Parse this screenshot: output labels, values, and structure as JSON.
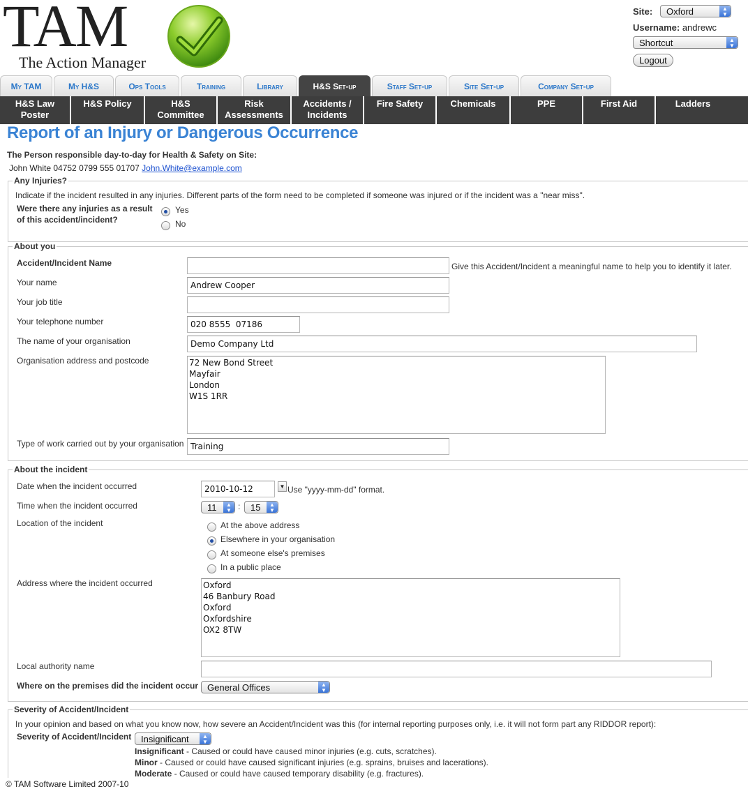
{
  "logo": {
    "wordmark": "TAM",
    "tagline": "The Action Manager"
  },
  "header": {
    "site_label": "Site:",
    "site_value": "Oxford",
    "username_label": "Username:",
    "username_value": "andrewc",
    "shortcut_value": "Shortcut",
    "logout_label": "Logout"
  },
  "tabs": [
    "My TAM",
    "My H&S",
    "Ops Tools",
    "Training",
    "Library",
    "H&S Set-up",
    "Staff Set-up",
    "Site Set-up",
    "Company Set-up"
  ],
  "subnav": [
    "H&S Law\nPoster",
    "H&S Policy",
    "H&S\nCommittee",
    "Risk\nAssessments",
    "Accidents /\nIncidents",
    "Fire Safety",
    "Chemicals",
    "PPE",
    "First Aid",
    "Ladders"
  ],
  "page_title": "Report of an Injury or Dangerous Occurrence",
  "responsible_heading": "The Person responsible day-to-day for Health & Safety on Site:",
  "responsible_contact": "John White 04752 0799 555 01707",
  "responsible_email": "John.White@example.com",
  "injuries": {
    "legend": "Any Injuries?",
    "intro": "Indicate if the incident resulted in any injuries. Different parts of the form need to be completed if someone was injured or if the incident was a \"near miss\".",
    "question": "Were there any injuries as a result\nof this accident/incident?",
    "options": [
      "Yes",
      "No"
    ],
    "selected": "Yes"
  },
  "about_you": {
    "legend": "About you",
    "incident_name_label": "Accident/Incident Name",
    "incident_name_value": "",
    "incident_name_help": "Give this Accident/Incident a meaningful name to help you to identify it later.",
    "name_label": "Your name",
    "name_value": "Andrew Cooper",
    "job_label": "Your job title",
    "job_value": "",
    "phone_label": "Your telephone number",
    "phone_value": "020 8555  07186",
    "org_label": "The name of your organisation",
    "org_value": "Demo Company Ltd",
    "address_label": "Organisation address and postcode",
    "address_value": "72 New Bond Street\nMayfair\nLondon\nW1S 1RR",
    "work_label": "Type of work carried out by your organisation",
    "work_value": "Training"
  },
  "incident": {
    "legend": "About the incident",
    "date_label": "Date when the incident occurred",
    "date_value": "2010-10-12",
    "date_help": "Use \"yyyy-mm-dd\" format.",
    "time_label": "Time when the incident occurred",
    "hour": "11",
    "minute": "15",
    "time_sep": ":",
    "location_label": "Location of the incident",
    "location_options": [
      "At the above address",
      "Elsewhere in your organisation",
      "At someone else's premises",
      "In a public place"
    ],
    "location_selected": "Elsewhere in your organisation",
    "address_label": "Address where the incident occurred",
    "address_value": "Oxford\n46 Banbury Road\nOxford\nOxfordshire\nOX2 8TW",
    "authority_label": "Local authority name",
    "authority_value": "",
    "premises_label": "Where on the premises did the incident occur",
    "premises_value": "General Offices"
  },
  "severity": {
    "legend": "Severity of Accident/Incident",
    "intro": "In your opinion and based on what you know now, how severe an Accident/Incident was this (for internal reporting purposes only, i.e. it will not form part any RIDDOR report):",
    "label": "Severity of Accident/Incident",
    "value": "Insignificant",
    "levels": [
      {
        "name": "Insignificant",
        "desc": " - Caused or could have caused minor injuries (e.g. cuts, scratches)."
      },
      {
        "name": "Minor",
        "desc": " - Caused or could have caused significant injuries (e.g. sprains, bruises and lacerations)."
      },
      {
        "name": "Moderate",
        "desc": " - Caused or could have caused temporary disability (e.g. fractures)."
      }
    ]
  },
  "footer": "© TAM Software Limited 2007-10",
  "colors": {
    "accent": "#3a83d4",
    "tab_text": "#2b77c9",
    "nav_dark": "#3d3d3d"
  }
}
